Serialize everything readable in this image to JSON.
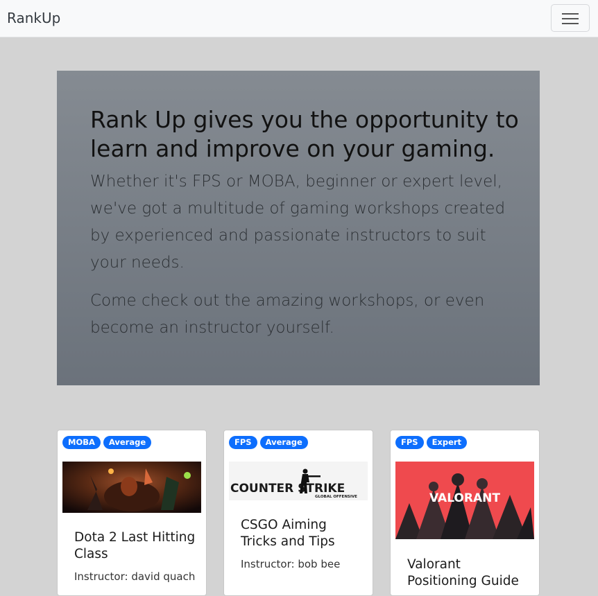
{
  "nav": {
    "brand": "RankUp",
    "toggle_icon": "hamburger-menu-icon"
  },
  "hero": {
    "heading": "Rank Up gives you the opportunity to learn and improve on your gaming.",
    "paragraph1": "Whether it's FPS or MOBA, beginner or expert level, we've got a multitude of gaming workshops created by experienced and passionate instructors to suit your needs.",
    "paragraph2": "Come check out the amazing workshops, or even become an instructor yourself."
  },
  "cards": [
    {
      "tags": [
        "MOBA",
        "Average"
      ],
      "image_text": "",
      "title": "Dota 2 Last Hitting Class",
      "instructor": "Instructor: david quach"
    },
    {
      "tags": [
        "FPS",
        "Average"
      ],
      "image_text": "COUNTER STRIKE",
      "image_subtext": "GLOBAL OFFENSIVE",
      "title": "CSGO Aiming Tricks and Tips",
      "instructor": "Instructor: bob bee"
    },
    {
      "tags": [
        "FPS",
        "Expert"
      ],
      "image_text": "VALORANT",
      "title": "Valorant Positioning Guide",
      "instructor": ""
    }
  ],
  "colors": {
    "badge": "#0d6efd",
    "background": "#d3d3d3",
    "hero_top": "#858b92",
    "hero_bottom": "#6b727b"
  }
}
